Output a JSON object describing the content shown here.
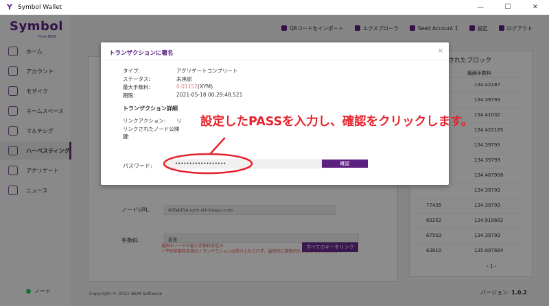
{
  "window": {
    "title": "Symbol Wallet",
    "controls": [
      "—",
      "☐",
      "✕"
    ]
  },
  "sidebar": {
    "logo": "Symbol",
    "logo_sub": "From NEM",
    "items": [
      {
        "label": "ホーム"
      },
      {
        "label": "アカウント"
      },
      {
        "label": "モザイク"
      },
      {
        "label": "ネームスペース"
      },
      {
        "label": "マルチシグ"
      },
      {
        "label": "ハーベスティング"
      },
      {
        "label": "アグリゲート"
      },
      {
        "label": "ニュース"
      }
    ],
    "active_index": 5,
    "node_status": "ノード"
  },
  "topbar": {
    "qr_import": "QRコードをインポート",
    "explorer": "エクスプローラ",
    "account": "Seed Account 1",
    "settings": "設定",
    "logout": "ログアウト"
  },
  "background": {
    "right_panel_title": "されたブロック",
    "right_panel_header": "報酬手数料",
    "blocks": [
      {
        "height": "",
        "fee": "134.42187"
      },
      {
        "height": "",
        "fee": "134.39793"
      },
      {
        "height": "",
        "fee": "134.41032"
      },
      {
        "height": "",
        "fee": "134.422185"
      },
      {
        "height": "",
        "fee": "134.39793"
      },
      {
        "height": "",
        "fee": "134.39793"
      },
      {
        "height": "",
        "fee": "134.467908"
      },
      {
        "height": "",
        "fee": "134.39793"
      },
      {
        "height": "77435",
        "fee": "134.39793"
      },
      {
        "height": "69252",
        "fee": "134.919682"
      },
      {
        "height": "67503",
        "fee": "134.39793"
      },
      {
        "height": "63610",
        "fee": "135.097684"
      }
    ],
    "pager": "‹   1   ›",
    "node_url_label": "ノードURL:",
    "node_url_value": "00fabf14.xym.stir-hosyu.com",
    "fee_label": "手数料:",
    "fee_value": "最速",
    "fee_warning_1": "選択中ノードの最小手数料設定(0",
    "fee_warning_2": "ト平均手数料未満のトランザクションは受け入れられず、最終的に期限切れとなる場合があります",
    "link_all_keys": "すべてのキーをリンク",
    "copyright": "Copyright © 2021 NEM Software",
    "version_label": "バージョン: ",
    "version": "1.0.2"
  },
  "modal": {
    "title": "トランザクションに署名",
    "close": "×",
    "type_label": "タイプ:",
    "type_value": "アグリゲートコンプリート",
    "status_label": "ステータス:",
    "status_value": "未承認",
    "max_fee_label": "最大手数料:",
    "max_fee_amount": "0.01152",
    "max_fee_unit": "(XYM)",
    "deadline_label": "期限:",
    "deadline_value": "2021-05-18 00:29:48.521",
    "details_title": "トランザクション詳細",
    "link_action_label": "リンクアクション:",
    "link_action_value": "リ",
    "linked_node_key_label_1": "リンクされたノード公開",
    "linked_node_key_label_2": "鍵:",
    "password_label": "パスワード:",
    "password_value": "••••••••••••••••••",
    "confirm_label": "確認"
  },
  "annotation": {
    "text": "設定したPASSを入力し、確認をクリックします。",
    "color": "#e8222b"
  }
}
